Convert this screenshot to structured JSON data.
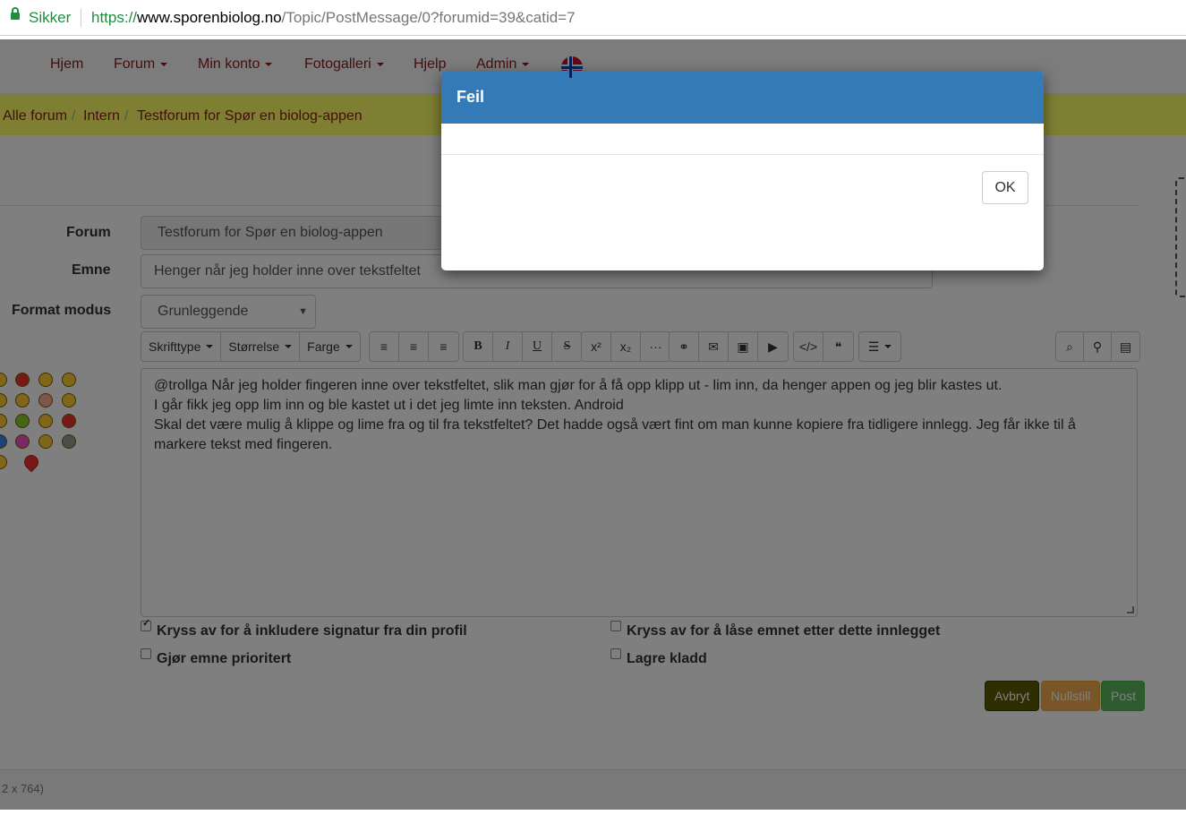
{
  "browser": {
    "secure_label": "Sikker",
    "url_scheme": "https://",
    "url_host": "www.sporenbiolog.no",
    "url_path": "/Topic/PostMessage/0?forumid=39&catid=7"
  },
  "navbar": {
    "items": [
      {
        "label": "Hjem"
      },
      {
        "label": "Forum"
      },
      {
        "label": "Min konto"
      },
      {
        "label": "Fotogalleri"
      },
      {
        "label": "Hjelp"
      },
      {
        "label": "Admin"
      }
    ]
  },
  "breadcrumb": {
    "items": [
      {
        "label": "Alle forum"
      },
      {
        "label": "Intern"
      },
      {
        "label": "Testforum for Spør en biolog-appen"
      }
    ],
    "separator": "/"
  },
  "form": {
    "forum_label": "Forum",
    "forum_value": "Testforum for Spør en biolog-appen",
    "subject_label": "Emne",
    "subject_value": "Henger når jeg holder inne over tekstfeltet",
    "format_label": "Format modus",
    "format_value": "Grunleggende"
  },
  "toolbar": {
    "font_label": "Skrifttype",
    "size_label": "Størrelse",
    "color_label": "Farge"
  },
  "editor": {
    "line1": "@trollga Når jeg holder fingeren inne over tekstfeltet, slik man gjør for å få opp klipp ut - lim inn, da henger appen og jeg blir kastes ut.",
    "line2": "I går fikk jeg opp lim inn og ble kastet ut i det jeg limte inn teksten. Android",
    "line3": "Skal det være mulig å klippe og lime fra og til fra tekstfeltet? Det hadde også vært fint om man kunne kopiere fra tidligere innlegg. Jeg får ikke til å markere tekst med fingeren."
  },
  "options": {
    "signature_label": "Kryss av for å inkludere signatur fra din profil",
    "signature_checked": true,
    "lock_label": "Kryss av for å låse emnet etter dette innlegget",
    "lock_checked": false,
    "priority_label": "Gjør emne prioritert",
    "priority_checked": false,
    "draft_label": "Lagre kladd",
    "draft_checked": false
  },
  "buttons": {
    "cancel": "Avbryt",
    "reset": "Nullstill",
    "post": "Post"
  },
  "footer": {
    "text": "2 x 764)"
  },
  "modal": {
    "title": "Feil",
    "ok_label": "OK"
  },
  "colors": {
    "modal_header": "#337ab7",
    "breadcrumb_bg": "#ffff66",
    "link": "#8b1a1a",
    "cancel_btn": "#333300",
    "reset_btn": "#f0ad4e",
    "post_btn": "#5cb85c"
  }
}
